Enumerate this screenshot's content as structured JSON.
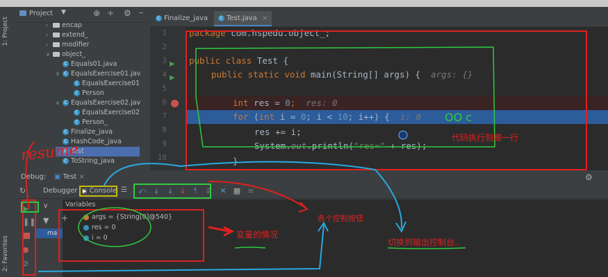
{
  "left_bar": {
    "project_label": "1: Project",
    "favorites_label": "2: Favorites"
  },
  "project_panel": {
    "title": "Project",
    "tree": [
      {
        "label": "encap",
        "kind": "folder",
        "expanded": false
      },
      {
        "label": "extend_",
        "kind": "folder",
        "expanded": false
      },
      {
        "label": "modifier",
        "kind": "folder",
        "expanded": false
      },
      {
        "label": "object_",
        "kind": "folder",
        "expanded": true
      },
      {
        "label": "Equals01.java",
        "kind": "class",
        "expanded": false
      },
      {
        "label": "EqualsExercise01.jav",
        "kind": "class",
        "expanded": true
      },
      {
        "label": "EqualsExercise01",
        "kind": "class",
        "expanded": false
      },
      {
        "label": "Person",
        "kind": "class",
        "expanded": false
      },
      {
        "label": "EqualsExercise02.jav",
        "kind": "class",
        "expanded": true
      },
      {
        "label": "EqualsExercise02",
        "kind": "class",
        "expanded": false
      },
      {
        "label": "Person_",
        "kind": "class",
        "expanded": false
      },
      {
        "label": "Finalize_java",
        "kind": "class",
        "expanded": false
      },
      {
        "label": "HashCode_java",
        "kind": "class",
        "expanded": false
      },
      {
        "label": "Test",
        "kind": "class",
        "expanded": false
      },
      {
        "label": "ToString_java",
        "kind": "class",
        "expanded": false
      }
    ]
  },
  "editor": {
    "tabs": [
      {
        "label": "Finalize_java",
        "active": false
      },
      {
        "label": "Test.java",
        "active": true
      }
    ],
    "line_numbers": [
      "1",
      "2",
      "3",
      "4",
      "5",
      "6",
      "7",
      "8",
      "9",
      "10"
    ],
    "code": {
      "l1_kw": "package",
      "l1_rest": " com.hspedu.object_;",
      "l3_kw1": "public",
      "l3_kw2": " class",
      "l3_rest": " Test {",
      "l4_kw1": "public",
      "l4_kw2": " static",
      "l4_kw3": " void",
      "l4_rest": " main(String[] args) {",
      "l4_hint": "args: {}",
      "l6_kw": "int",
      "l6_rest": " res = ",
      "l6_num": "0",
      "l6_semi": ";",
      "l6_hint": "res: 0",
      "l7_kw": "for",
      "l7_p1": " (",
      "l7_kw2": "int",
      "l7_p2": " i = ",
      "l7_num1": "0",
      "l7_p3": "; i < ",
      "l7_num2": "10",
      "l7_p4": "; i++) {",
      "l7_hint": "i: 0",
      "l8": "res += i;",
      "l9_a": "System.",
      "l9_out": "out",
      "l9_b": ".println(",
      "l9_str": "\"res=\"",
      "l9_c": " + res);",
      "l10": "}"
    }
  },
  "debug": {
    "title": "Debug:",
    "run_tab": "Test",
    "tab_debugger": "Debugger",
    "tab_console": "Console",
    "variables_label": "Variables",
    "frame_label": "ma",
    "variables": [
      {
        "text": "args = {String[0]@540}",
        "color": "#cc7832"
      },
      {
        "text": "res = 0",
        "color": "#3592c4"
      },
      {
        "text": "i = 0",
        "color": "#3592c4"
      }
    ]
  },
  "annotations": {
    "resume": "resume",
    "oo_c": "OO c",
    "which_line": "代码执行到哪一行",
    "var_status": "变量的情况",
    "step_buttons": "各个控制按钮",
    "switch_console": "切换到输出控制台.."
  },
  "colors": {
    "annotation_red": "#e02020",
    "annotation_green": "#2ecc40",
    "annotation_blue": "#29a9e0",
    "annotation_yellow": "#f2e600",
    "exec_line_bg": "#2d5c9b",
    "breakpoint_line_bg": "#3a2323"
  }
}
